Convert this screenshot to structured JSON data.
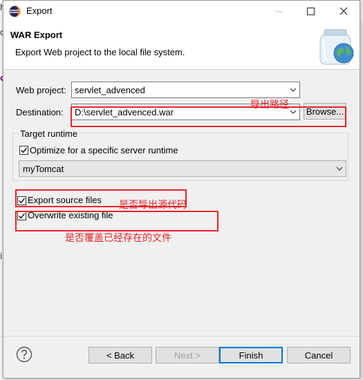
{
  "window": {
    "title": "Export",
    "icon": "eclipse-icon"
  },
  "banner": {
    "title": "WAR Export",
    "description": "Export Web project to the local file system.",
    "art_icon": "jar-globe-icon"
  },
  "form": {
    "web_project_label": "Web project:",
    "web_project_value": "servlet_advenced",
    "destination_label": "Destination:",
    "destination_value": "D:\\servlet_advenced.war",
    "browse_label": "Browse...",
    "target_runtime_label": "Target runtime",
    "optimize_label": "Optimize for a specific server runtime",
    "optimize_checked": true,
    "runtime_value": "myTomcat",
    "export_source_label": "Export source files",
    "export_source_checked": true,
    "overwrite_label": "Overwrite existing file",
    "overwrite_checked": true
  },
  "annotations": {
    "destination_note": "导出路径",
    "source_note": "是否导出源代码",
    "overwrite_note": "是否覆盖已经存在的文件",
    "color": "#e8232a"
  },
  "buttons": {
    "back": "< Back",
    "next": "Next >",
    "finish": "Finish",
    "cancel": "Cancel"
  },
  "background": {
    "left_fragments": [
      "ho",
      "d",
      "c",
      "is"
    ]
  }
}
